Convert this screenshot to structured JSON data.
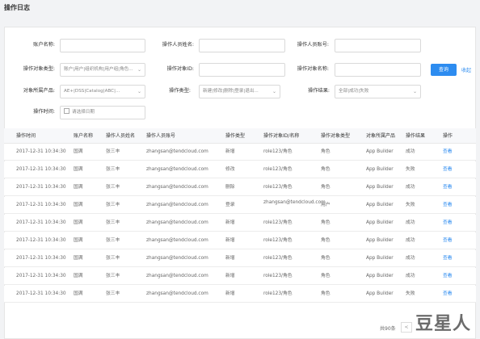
{
  "page_title": "操作日志",
  "filters": {
    "account_name": {
      "label": "账户名称:",
      "value": ""
    },
    "operator_name": {
      "label": "操作人员姓名:",
      "value": ""
    },
    "operator_account": {
      "label": "操作人员账号:",
      "value": ""
    },
    "object_type": {
      "label": "操作对象类型:",
      "value": "账户|用户|组织机构|用户组|角色..."
    },
    "object_id": {
      "label": "操作对象ID:",
      "value": ""
    },
    "object_name": {
      "label": "操作对象名称:",
      "value": ""
    },
    "product": {
      "label": "对象所属产品:",
      "value": "AE+|DSS|Catalog|ABC|..."
    },
    "op_type": {
      "label": "操作类型:",
      "value": "新建|修改|删除|登录|退出..."
    },
    "op_result": {
      "label": "操作结果:",
      "value": "全部|成功|失败"
    },
    "op_time": {
      "label": "操作时间:",
      "placeholder": "请选择日期"
    }
  },
  "buttons": {
    "search": "查询",
    "collapse": "收起"
  },
  "table": {
    "headers": [
      "操作时间",
      "账户名称",
      "操作人员姓名",
      "操作人员账号",
      "操作类型",
      "操作对象ID/名称",
      "操作对象类型",
      "对象所属产品",
      "操作结果",
      "操作"
    ],
    "rows": [
      [
        "2017-12-31 10:34:30",
        "国满",
        "张三丰",
        "zhangsan@tendcloud.com",
        "新增",
        "role123/角色",
        "角色",
        "App Builder",
        "成功",
        "查看"
      ],
      [
        "2017-12-31 10:34:30",
        "国满",
        "张三丰",
        "zhangsan@tendcloud.com",
        "修改",
        "role123/角色",
        "角色",
        "App Builder",
        "失败",
        "查看"
      ],
      [
        "2017-12-31 10:34:30",
        "国满",
        "张三丰",
        "zhangsan@tendcloud.com",
        "删除",
        "role123/角色",
        "角色",
        "App Builder",
        "成功",
        "查看"
      ],
      [
        "2017-12-31 10:34:30",
        "国满",
        "张三丰",
        "zhangsan@tendcloud.com",
        "登录",
        "zhangsan@tendcloud.com",
        "用户",
        "App Builder",
        "失败",
        "查看"
      ],
      [
        "2017-12-31 10:34:30",
        "国满",
        "张三丰",
        "zhangsan@tendcloud.com",
        "新增",
        "role123/角色",
        "角色",
        "App Builder",
        "成功",
        "查看"
      ],
      [
        "2017-12-31 10:34:30",
        "国满",
        "张三丰",
        "zhangsan@tendcloud.com",
        "新增",
        "role123/角色",
        "角色",
        "App Builder",
        "成功",
        "查看"
      ],
      [
        "2017-12-31 10:34:30",
        "国满",
        "张三丰",
        "zhangsan@tendcloud.com",
        "新增",
        "role123/角色",
        "角色",
        "App Builder",
        "成功",
        "查看"
      ],
      [
        "2017-12-31 10:34:30",
        "国满",
        "张三丰",
        "zhangsan@tendcloud.com",
        "新增",
        "role123/角色",
        "角色",
        "App Builder",
        "成功",
        "查看"
      ],
      [
        "2017-12-31 10:34:30",
        "国满",
        "张三丰",
        "zhangsan@tendcloud.com",
        "新增",
        "role123/角色",
        "角色",
        "App Builder",
        "失败",
        "查看"
      ]
    ]
  },
  "pagination": {
    "total": "共90条",
    "prev": "<"
  },
  "watermark": "豆星人"
}
